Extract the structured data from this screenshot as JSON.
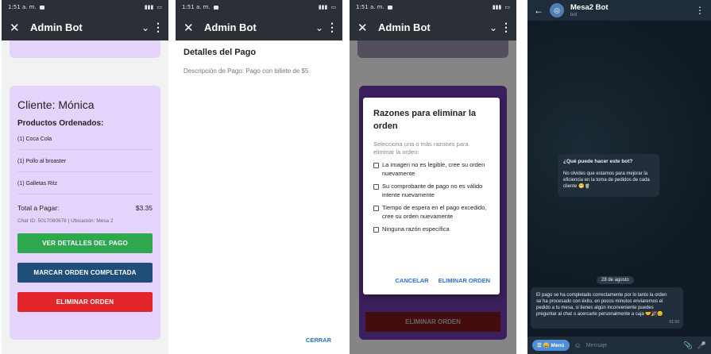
{
  "status": {
    "time": "1:51 a. m."
  },
  "admin_appbar": {
    "close": "✕",
    "title": "Admin Bot",
    "chevron": "⌄",
    "more": "⋮"
  },
  "order": {
    "client": "Cliente: Mónica",
    "products_heading": "Productos Ordenados:",
    "items": [
      "(1) Coca Cola",
      "(1) Pollo al broaster",
      "(1) Galletas Ritz"
    ],
    "total_label": "Total a Pagar:",
    "total_value": "$3.35",
    "meta": "Chat ID: 5017080678 | Ubicación: Mesa 2",
    "btn_details": "VER DETALLES DEL PAGO",
    "btn_complete": "MARCAR ORDEN COMPLETADA",
    "btn_delete": "ELIMINAR ORDEN",
    "colors": {
      "card": "#e4d4fb",
      "green": "#2ea84f",
      "blue": "#1f4e79",
      "red": "#e2262a"
    }
  },
  "payment": {
    "title": "Detalles del Pago",
    "desc": "Descripción de Pago: Pago con billete de $5",
    "close": "CERRAR"
  },
  "dialog": {
    "title": "Razones para eliminar la orden",
    "subtitle": "Selecciona una o más razones para eliminar la orden:",
    "options": [
      "La imagen no es legible, cree su orden nuevamente",
      "Su comprobante de pago no es válido intente nuevamente",
      "Tiempo de espera en el pago excedido, cree su orden nuevamente",
      "Ninguna razón específica"
    ],
    "cancel": "CANCELAR",
    "confirm": "ELIMINAR ORDEN",
    "bg_button": "ELIMINAR ORDEN"
  },
  "telegram": {
    "back": "←",
    "name": "Mesa2 Bot",
    "sub": "bot",
    "more": "⋮",
    "bubble1_title": "¿Qué puede hacer este bot?",
    "bubble1_text": "No olvides que estamos para mejorar la eficiencia en la toma de pedidos de cada cliente 😁🧋",
    "date": "28 de agosto",
    "bubble2_text": "El pago se ha completado correctamente por lo tanto la orden se ha procesado con éxito, en pocos minutos enviaremos el pedido a tu mesa, si tienes algún inconveniente puedes preguntar al chat o acercarte personalmente a caja 🤝🎉😊",
    "bubble2_time": "01:50",
    "menu": "☰ 😀 Menú",
    "placeholder": "Mensaje",
    "emoji_icon": "☺",
    "attach_icon": "📎",
    "mic_icon": "🎤"
  }
}
